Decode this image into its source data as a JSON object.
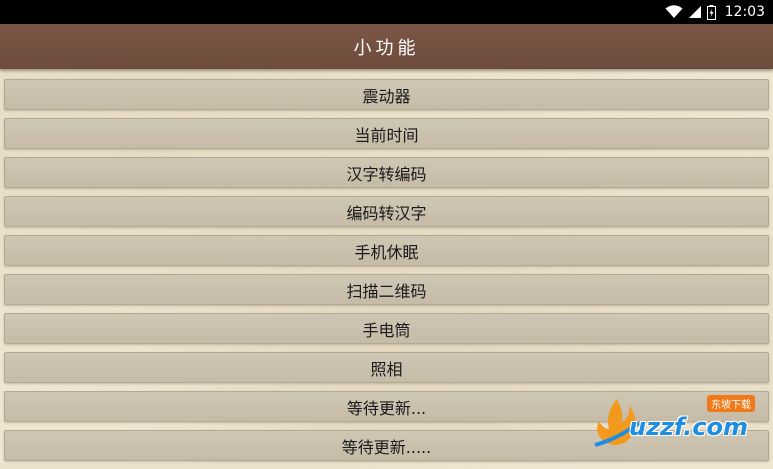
{
  "status_bar": {
    "time": "12:03",
    "icons": [
      "wifi-icon",
      "cell-signal-icon",
      "battery-icon"
    ]
  },
  "header": {
    "title": "小功能"
  },
  "menu": {
    "items": [
      {
        "label": "震动器"
      },
      {
        "label": "当前时间"
      },
      {
        "label": "汉字转编码"
      },
      {
        "label": "编码转汉字"
      },
      {
        "label": "手机休眠"
      },
      {
        "label": "扫描二维码"
      },
      {
        "label": "手电筒"
      },
      {
        "label": "照相"
      },
      {
        "label": "等待更新..."
      },
      {
        "label": "等待更新....."
      }
    ]
  },
  "watermark": {
    "text": "uzzf.com",
    "badge": "东坡下载"
  },
  "colors": {
    "status_bar": "#000000",
    "title_bar": "#74513f",
    "background": "#efe6d2",
    "button": "#cac1ae",
    "button_text": "#1a1a1a"
  }
}
